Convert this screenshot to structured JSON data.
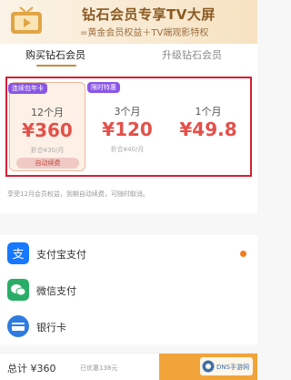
{
  "banner": {
    "title": "钻石会员专享TV大屏",
    "subtitle": "=黄金会员权益＋TV端观影特权",
    "icon": "tv-icon"
  },
  "tabs": [
    {
      "label": "购买钻石会员",
      "active": true
    },
    {
      "label": "升级钻石会员",
      "active": false
    }
  ],
  "plans": [
    {
      "badge": "连续包年卡",
      "duration": "12个月",
      "price": "¥360",
      "note": "折合¥30/月",
      "action": "自动续费",
      "selected": true
    },
    {
      "badge": "限时特惠",
      "duration": "3个月",
      "price": "¥120",
      "note": "折合¥40/月",
      "selected": false
    },
    {
      "duration": "1个月",
      "price": "¥49.8",
      "selected": false
    }
  ],
  "description": "享受12月会员权益，到期自动续费，可随时取消。",
  "payment": {
    "methods": [
      {
        "label": "支付宝支付",
        "icon": "alipay-icon",
        "color": "#1677ff",
        "selected": true
      },
      {
        "label": "微信支付",
        "icon": "wechat-icon",
        "color": "#2aae67",
        "selected": false
      },
      {
        "label": "银行卡",
        "icon": "bank-card-icon",
        "color": "#2f7be0",
        "selected": false
      }
    ]
  },
  "bottom": {
    "total": "总计 ¥360",
    "saved": "已优惠138元"
  },
  "watermark": {
    "text": "DNS手游网"
  },
  "colors": {
    "accent": "#e3504a",
    "gold": "#c58a3b",
    "highlight_frame": "#d61f34",
    "pay_button": "#f2a43a"
  }
}
